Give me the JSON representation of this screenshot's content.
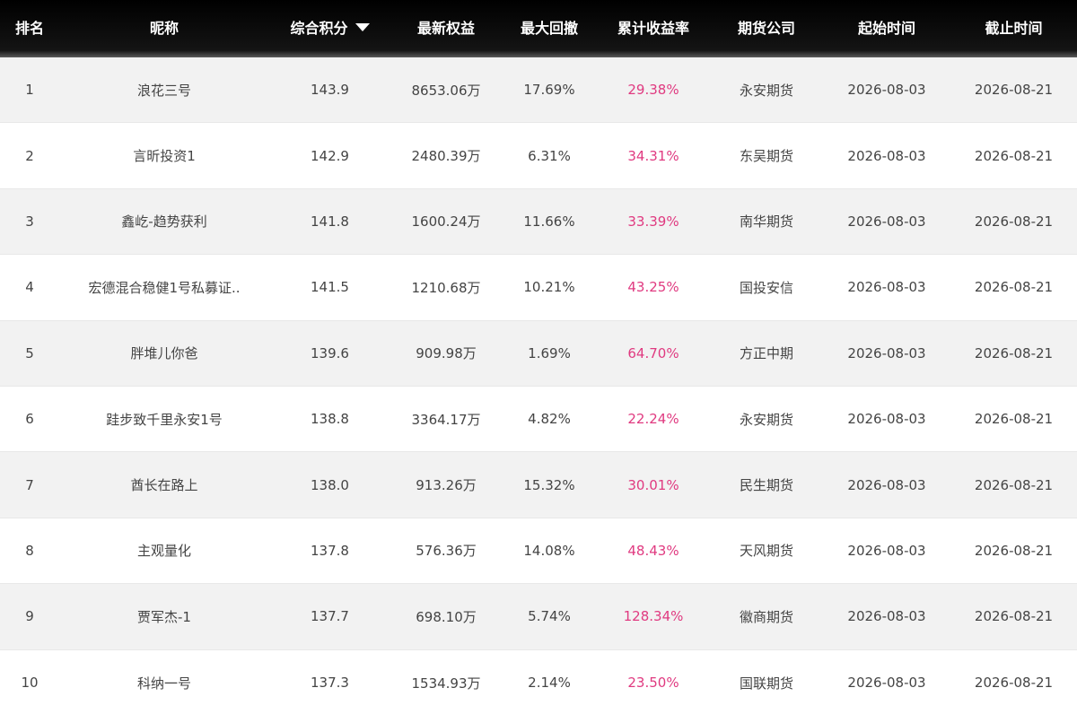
{
  "header": {
    "rank": "排名",
    "name": "昵称",
    "score": "综合积分",
    "equity": "最新权益",
    "drawdown": "最大回撤",
    "return": "累计收益率",
    "broker": "期货公司",
    "start": "起始时间",
    "end": "截止时间"
  },
  "rows": [
    {
      "rank": "1",
      "name": "浪花三号",
      "score": "143.9",
      "equity": "8653.06万",
      "drawdown": "17.69%",
      "return": "29.38%",
      "broker": "永安期货",
      "start": "2026-08-03",
      "end": "2026-08-21"
    },
    {
      "rank": "2",
      "name": "言昕投资1",
      "score": "142.9",
      "equity": "2480.39万",
      "drawdown": "6.31%",
      "return": "34.31%",
      "broker": "东吴期货",
      "start": "2026-08-03",
      "end": "2026-08-21"
    },
    {
      "rank": "3",
      "name": "鑫屹-趋势获利",
      "score": "141.8",
      "equity": "1600.24万",
      "drawdown": "11.66%",
      "return": "33.39%",
      "broker": "南华期货",
      "start": "2026-08-03",
      "end": "2026-08-21"
    },
    {
      "rank": "4",
      "name": "宏德混合稳健1号私募证..",
      "score": "141.5",
      "equity": "1210.68万",
      "drawdown": "10.21%",
      "return": "43.25%",
      "broker": "国投安信",
      "start": "2026-08-03",
      "end": "2026-08-21"
    },
    {
      "rank": "5",
      "name": "胖堆儿你爸",
      "score": "139.6",
      "equity": "909.98万",
      "drawdown": "1.69%",
      "return": "64.70%",
      "broker": "方正中期",
      "start": "2026-08-03",
      "end": "2026-08-21"
    },
    {
      "rank": "6",
      "name": "跬步致千里永安1号",
      "score": "138.8",
      "equity": "3364.17万",
      "drawdown": "4.82%",
      "return": "22.24%",
      "broker": "永安期货",
      "start": "2026-08-03",
      "end": "2026-08-21"
    },
    {
      "rank": "7",
      "name": "酋长在路上",
      "score": "138.0",
      "equity": "913.26万",
      "drawdown": "15.32%",
      "return": "30.01%",
      "broker": "民生期货",
      "start": "2026-08-03",
      "end": "2026-08-21"
    },
    {
      "rank": "8",
      "name": "主观量化",
      "score": "137.8",
      "equity": "576.36万",
      "drawdown": "14.08%",
      "return": "48.43%",
      "broker": "天风期货",
      "start": "2026-08-03",
      "end": "2026-08-21"
    },
    {
      "rank": "9",
      "name": "贾军杰-1",
      "score": "137.7",
      "equity": "698.10万",
      "drawdown": "5.74%",
      "return": "128.34%",
      "broker": "徽商期货",
      "start": "2026-08-03",
      "end": "2026-08-21"
    },
    {
      "rank": "10",
      "name": "科纳一号",
      "score": "137.3",
      "equity": "1534.93万",
      "drawdown": "2.14%",
      "return": "23.50%",
      "broker": "国联期货",
      "start": "2026-08-03",
      "end": "2026-08-21"
    }
  ],
  "colors": {
    "header_bg": "#111111",
    "header_text": "#ffffff",
    "return_text": "#e03a80",
    "row_alt_bg": "#f2f2f2"
  },
  "icons": {
    "sort": "sort-descending-icon"
  }
}
